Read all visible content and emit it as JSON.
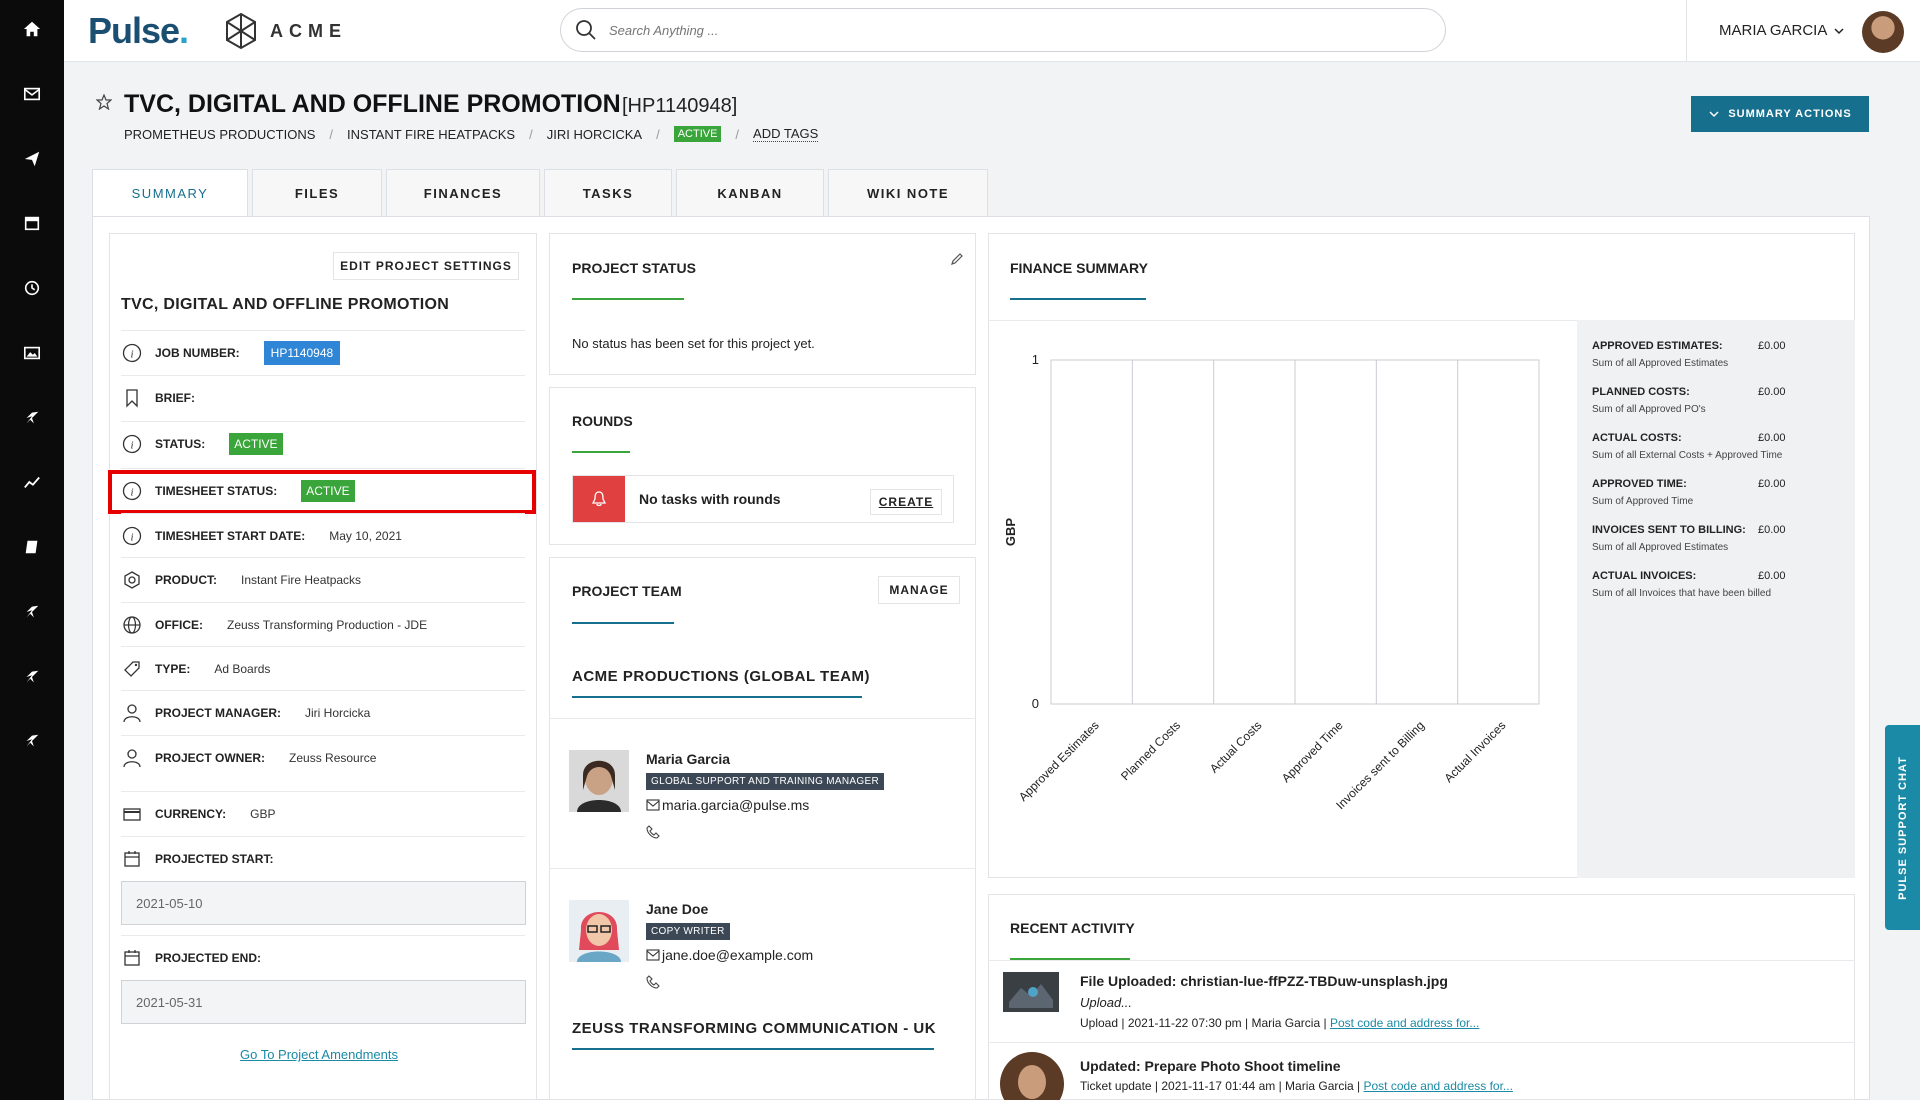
{
  "app": {
    "brand": "Pulse",
    "client_logo": "ACME"
  },
  "search": {
    "placeholder": "Search Anything ..."
  },
  "user": {
    "name": "MARIA GARCIA"
  },
  "project": {
    "title": "TVC, DIGITAL AND OFFLINE PROMOTION",
    "code": "[HP1140948]",
    "breadcrumb": [
      "PROMETHEUS PRODUCTIONS",
      "INSTANT FIRE HEATPACKS",
      "JIRI HORCICKA"
    ],
    "status_badge": "ACTIVE",
    "add_tags": "ADD TAGS",
    "summary_actions": "SUMMARY ACTIONS"
  },
  "tabs": [
    "SUMMARY",
    "FILES",
    "FINANCES",
    "TASKS",
    "KANBAN",
    "WIKI NOTE"
  ],
  "details": {
    "edit_button": "EDIT PROJECT SETTINGS",
    "name": "TVC, DIGITAL AND OFFLINE PROMOTION",
    "job_number_label": "JOB NUMBER:",
    "job_number": "HP1140948",
    "brief_label": "BRIEF:",
    "status_label": "STATUS:",
    "status": "ACTIVE",
    "timesheet_status_label": "TIMESHEET STATUS:",
    "timesheet_status": "ACTIVE",
    "timesheet_start_label": "TIMESHEET START DATE:",
    "timesheet_start": "May 10, 2021",
    "product_label": "PRODUCT:",
    "product": "Instant Fire Heatpacks",
    "office_label": "OFFICE:",
    "office": "Zeuss Transforming Production - JDE",
    "type_label": "TYPE:",
    "type": "Ad Boards",
    "pm_label": "PROJECT MANAGER:",
    "pm": "Jiri Horcicka",
    "owner_label": "PROJECT OWNER:",
    "owner": "Zeuss Resource",
    "currency_label": "CURRENCY:",
    "currency": "GBP",
    "projected_start_label": "PROJECTED START:",
    "projected_start": "2021-05-10",
    "projected_end_label": "PROJECTED END:",
    "projected_end": "2021-05-31",
    "amendments_link": "Go To Project Amendments"
  },
  "project_status": {
    "title": "PROJECT STATUS",
    "text": "No status has been set for this project yet."
  },
  "rounds": {
    "title": "ROUNDS",
    "text": "No tasks with rounds",
    "create": "CREATE"
  },
  "team": {
    "title": "PROJECT TEAM",
    "manage": "MANAGE",
    "group1": "ACME PRODUCTIONS (GLOBAL TEAM)",
    "group2": "ZEUSS TRANSFORMING COMMUNICATION - UK",
    "members": [
      {
        "name": "Maria Garcia",
        "role": "GLOBAL SUPPORT AND TRAINING MANAGER",
        "email": "maria.garcia@pulse.ms"
      },
      {
        "name": "Jane Doe",
        "role": "COPY WRITER",
        "email": "jane.doe@example.com"
      }
    ]
  },
  "finance": {
    "title": "FINANCE SUMMARY",
    "items": [
      {
        "label": "APPROVED ESTIMATES:",
        "value": "£0.00",
        "sub": "Sum of all Approved Estimates"
      },
      {
        "label": "PLANNED COSTS:",
        "value": "£0.00",
        "sub": "Sum of all Approved PO's"
      },
      {
        "label": "ACTUAL COSTS:",
        "value": "£0.00",
        "sub": "Sum of all External Costs + Approved Time"
      },
      {
        "label": "APPROVED TIME:",
        "value": "£0.00",
        "sub": "Sum of Approved Time"
      },
      {
        "label": "INVOICES SENT TO BILLING:",
        "value": "£0.00",
        "sub": "Sum of all Approved Estimates"
      },
      {
        "label": "ACTUAL INVOICES:",
        "value": "£0.00",
        "sub": "Sum of all Invoices that have been billed"
      }
    ]
  },
  "chart_data": {
    "type": "bar",
    "categories": [
      "Approved Estimates",
      "Planned Costs",
      "Actual Costs",
      "Approved Time",
      "Invoices sent to Billing",
      "Actual Invoices"
    ],
    "values": [
      0,
      0,
      0,
      0,
      0,
      0
    ],
    "ylabel": "GBP",
    "ylim": [
      0,
      1
    ],
    "yticks": [
      "0",
      "1"
    ],
    "grid": true
  },
  "activity": {
    "title": "RECENT ACTIVITY",
    "items": [
      {
        "title": "File Uploaded: christian-lue-ffPZZ-TBDuw-unsplash.jpg",
        "desc": "Upload...",
        "meta": "Upload | 2021-11-22 07:30 pm | Maria Garcia | ",
        "link": "Post code and address for..."
      },
      {
        "title": "Updated: Prepare Photo Shoot timeline",
        "meta": "Ticket update | 2021-11-17 01:44 am | Maria Garcia | ",
        "link": "Post code and address for..."
      }
    ]
  },
  "support_chat": "PULSE SUPPORT CHAT",
  "colors": {
    "accent": "#176f8e",
    "active_green": "#3aa53a",
    "job_blue": "#2f86d6",
    "highlight_red": "#e60000"
  }
}
